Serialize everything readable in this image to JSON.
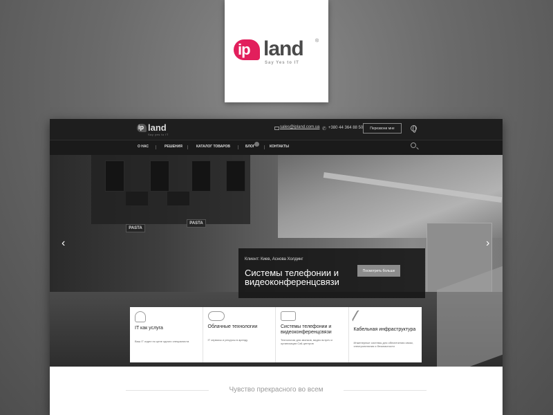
{
  "logo": {
    "mark": "ip",
    "word": "land",
    "reg": "®",
    "tagline": "Say Yes to IT"
  },
  "site": {
    "header": {
      "logo_mark": "ip",
      "logo_word": "land",
      "logo_tagline": "Say yes to IT",
      "email": "sales@ipland.com.ua",
      "phone": "+380 44 364 88 50",
      "callback_label": "Перезвони мне"
    },
    "nav": [
      {
        "label": "О НАС"
      },
      {
        "label": "РЕШЕНИЯ"
      },
      {
        "label": "КАТАЛОГ ТОВАРОВ"
      },
      {
        "label": "БЛОГ"
      },
      {
        "label": "КОНТАКТЫ"
      }
    ],
    "hero": {
      "boards": [
        "PASTA",
        "PASTA"
      ],
      "client": "Клиент: Киев, Аснова Холдинг",
      "title": "Системы телефонии и видеоконференцсвязи",
      "button": "Посмотреть больше",
      "prev": "‹",
      "next": "›"
    },
    "services": [
      {
        "icon": "person-icon",
        "title": "IT как услуга",
        "desc": "Ваш IT отдел по цене одного специалиста"
      },
      {
        "icon": "cloud-icon",
        "title": "Облачные технологии",
        "desc": "IT сервисы и ресурсы в аренду"
      },
      {
        "icon": "phone-system-icon",
        "title": "Системы телефонии и видеоконференцсвязи",
        "desc": "Технологии для звонков, видео встреч и организации Call-центров"
      },
      {
        "icon": "cable-icon",
        "title": "Кабельная инфраструктура",
        "desc": "Инженерные системы для обеспечения связи, электропитания и безопасности"
      }
    ],
    "services_next": "›",
    "tagline": "Чувство прекрасного во всем"
  },
  "colors": {
    "brand": "#e21f5c",
    "background": "#6a6a6a",
    "header": "#1e1e1e"
  }
}
